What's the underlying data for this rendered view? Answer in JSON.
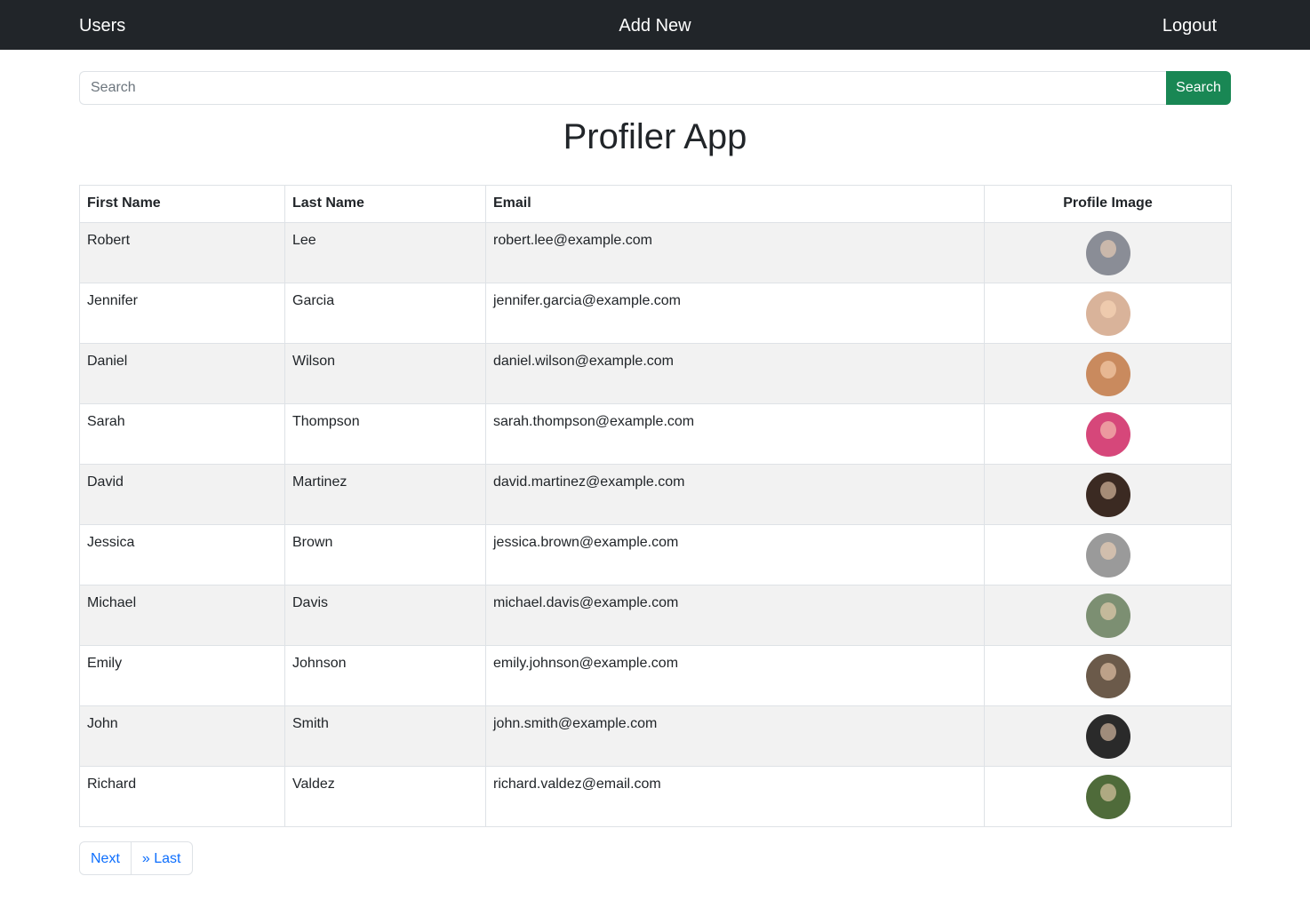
{
  "nav": {
    "users": "Users",
    "add_new": "Add New",
    "logout": "Logout"
  },
  "search": {
    "placeholder": "Search",
    "button_label": "Search"
  },
  "title": "Profiler App",
  "table": {
    "headers": {
      "first_name": "First Name",
      "last_name": "Last Name",
      "email": "Email",
      "profile_image": "Profile Image"
    },
    "rows": [
      {
        "first": "Robert",
        "last": "Lee",
        "email": "robert.lee@example.com",
        "avatar_color": "#8a8d96"
      },
      {
        "first": "Jennifer",
        "last": "Garcia",
        "email": "jennifer.garcia@example.com",
        "avatar_color": "#d9b39a"
      },
      {
        "first": "Daniel",
        "last": "Wilson",
        "email": "daniel.wilson@example.com",
        "avatar_color": "#c98a5e"
      },
      {
        "first": "Sarah",
        "last": "Thompson",
        "email": "sarah.thompson@example.com",
        "avatar_color": "#d6477a"
      },
      {
        "first": "David",
        "last": "Martinez",
        "email": "david.martinez@example.com",
        "avatar_color": "#3b2a22"
      },
      {
        "first": "Jessica",
        "last": "Brown",
        "email": "jessica.brown@example.com",
        "avatar_color": "#9a9a9a"
      },
      {
        "first": "Michael",
        "last": "Davis",
        "email": "michael.davis@example.com",
        "avatar_color": "#7c8f72"
      },
      {
        "first": "Emily",
        "last": "Johnson",
        "email": "emily.johnson@example.com",
        "avatar_color": "#6b5a4a"
      },
      {
        "first": "John",
        "last": "Smith",
        "email": "john.smith@example.com",
        "avatar_color": "#2a2a2a"
      },
      {
        "first": "Richard",
        "last": "Valdez",
        "email": "richard.valdez@email.com",
        "avatar_color": "#4f6b3a"
      }
    ]
  },
  "pagination": {
    "next": "Next",
    "last": "» Last"
  }
}
